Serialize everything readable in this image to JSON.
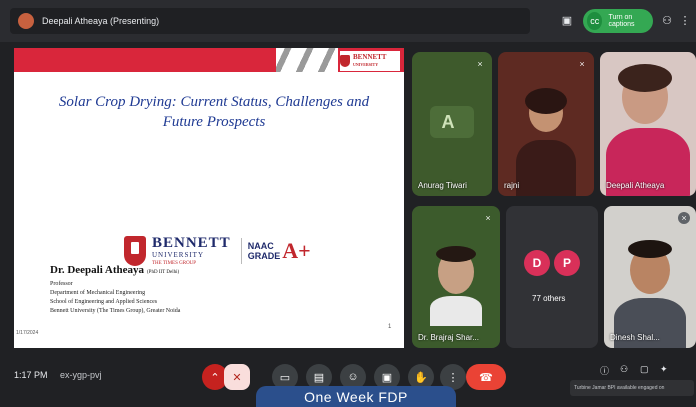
{
  "topbar": {
    "presenter_label": "Deepali Atheaya (Presenting)",
    "captions_label": "Turn on captions"
  },
  "slide": {
    "title_line1": "Solar Crop Drying: Current Status, Challenges and",
    "title_line2": "Future Prospects",
    "bennett_name": "BENNETT",
    "bennett_sub": "UNIVERSITY",
    "bennett_group": "THE TIMES GROUP",
    "naac_line1": "NAAC",
    "naac_line2": "GRADE",
    "naac_grade": "A+",
    "speaker_name": "Dr. Deepali Atheaya",
    "speaker_quals": "(PhD IIT Delhi)",
    "speaker_lines": [
      "Professor",
      "Department of Mechanical Engineering",
      "School of Engineering and Applied Sciences",
      "Bennett University (The Times Group), Greater Noida"
    ],
    "footer_date": "1/17/2024",
    "page_number": "1"
  },
  "participants": [
    {
      "name": "Anurag Tiwari",
      "initials": "A"
    },
    {
      "name": "rajni"
    },
    {
      "name": "Deepali Atheaya"
    },
    {
      "name": "Dr. Brajraj Shar..."
    },
    {
      "name": "77 others",
      "initials": [
        "D",
        "P"
      ]
    },
    {
      "name": "Dinesh Shal..."
    }
  ],
  "bottombar": {
    "time": "1:17 PM",
    "meeting_code": "ex-ygp-pvj",
    "banner": "One Week FDP",
    "toast": "Turbine Jamar BPI available engaged on"
  },
  "colors": {
    "accent_red": "#d9263b",
    "slide_title_blue": "#1f3a93",
    "captions_green": "#34a853",
    "others_pink": "#d93059",
    "banner_blue": "#2b4f8c"
  }
}
